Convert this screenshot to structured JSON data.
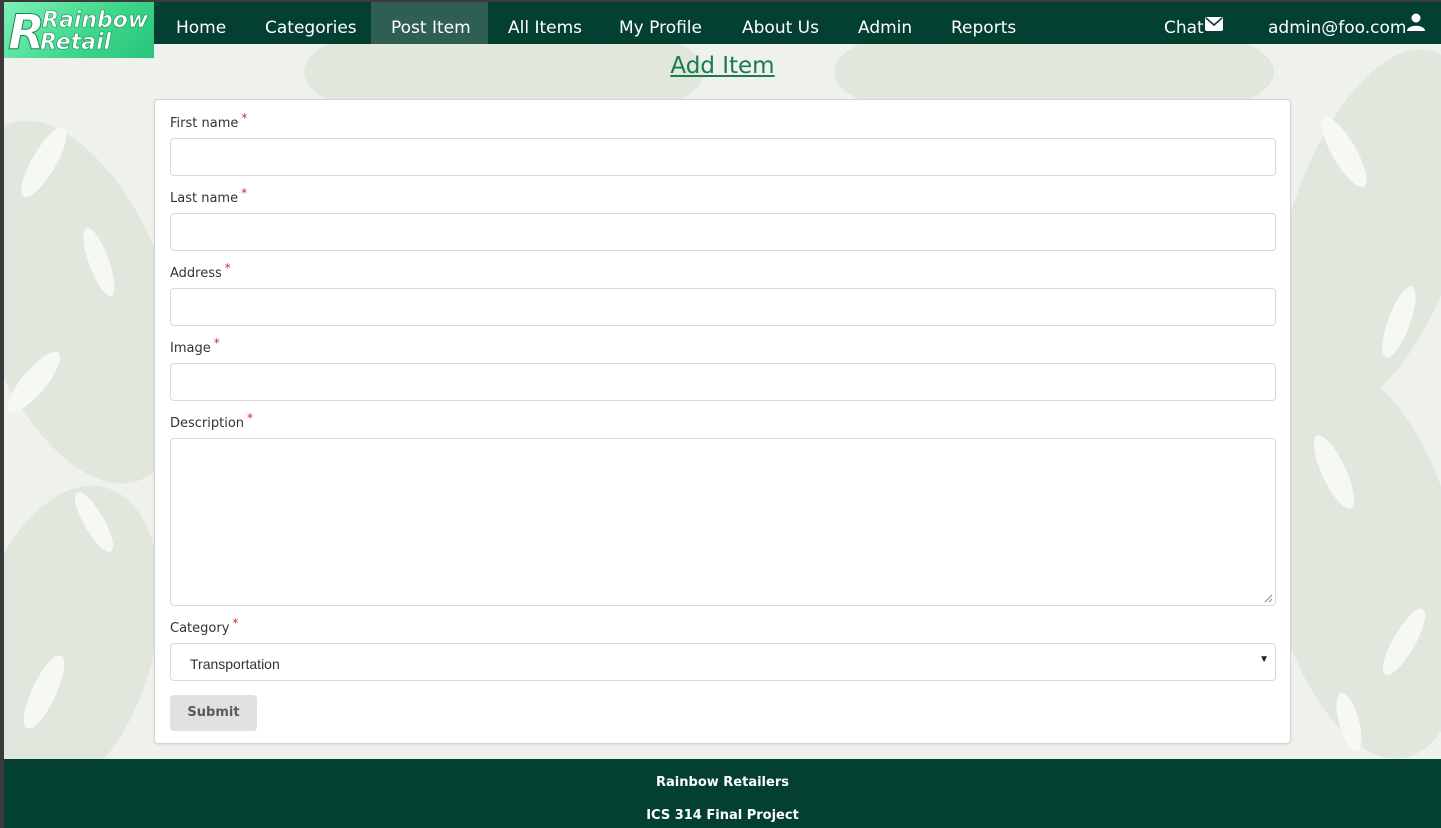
{
  "brand": {
    "line1": "Rainbow",
    "line2": "Retail"
  },
  "nav": {
    "items": [
      {
        "label": "Home"
      },
      {
        "label": "Categories"
      },
      {
        "label": "Post Item"
      },
      {
        "label": "All Items"
      },
      {
        "label": "My Profile"
      },
      {
        "label": "About Us"
      },
      {
        "label": "Admin"
      },
      {
        "label": "Reports"
      }
    ],
    "active": "Post Item",
    "chat_label": "Chat",
    "user_label": "admin@foo.com"
  },
  "page": {
    "title": "Add Item"
  },
  "form": {
    "first_name": {
      "label": "First name",
      "value": ""
    },
    "last_name": {
      "label": "Last name",
      "value": ""
    },
    "address": {
      "label": "Address",
      "value": ""
    },
    "image": {
      "label": "Image",
      "value": ""
    },
    "description": {
      "label": "Description",
      "value": ""
    },
    "category": {
      "label": "Category",
      "value": "Transportation"
    },
    "required_mark": "*",
    "submit_label": "Submit"
  },
  "footer": {
    "line1": "Rainbow Retailers",
    "line2": "ICS 314 Final Project"
  },
  "colors": {
    "nav_bg": "#034031",
    "accent": "#1b7a52",
    "required": "#db2828",
    "button_bg": "#e0e1e2"
  },
  "icons": {
    "chat": "envelope-icon",
    "user": "user-icon"
  }
}
